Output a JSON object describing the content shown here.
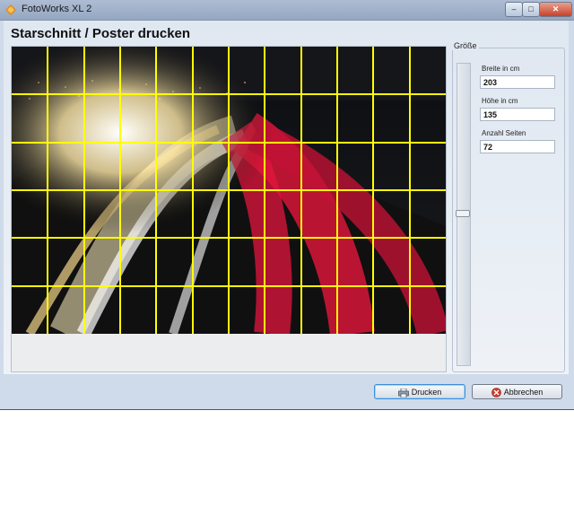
{
  "window": {
    "title": "FotoWorks XL 2"
  },
  "page": {
    "title": "Starschnitt / Poster drucken"
  },
  "size_group": {
    "label": "Größe",
    "slider_value": 0.42,
    "width_label": "Breite in cm",
    "width_value": "203",
    "height_label": "Höhe in cm",
    "height_value": "135",
    "pages_label": "Anzahl Seiten",
    "pages_value": "72"
  },
  "grid": {
    "columns": 12,
    "rows": 6,
    "color": "#ffff00"
  },
  "buttons": {
    "print_label": "Drucken",
    "cancel_label": "Abbrechen"
  },
  "icons": {
    "print": "printer-icon",
    "cancel": "cancel-icon",
    "app": "fotoworks-logo-icon"
  },
  "colors": {
    "accent": "#3d8fd7",
    "cancel": "#d23a2a"
  }
}
